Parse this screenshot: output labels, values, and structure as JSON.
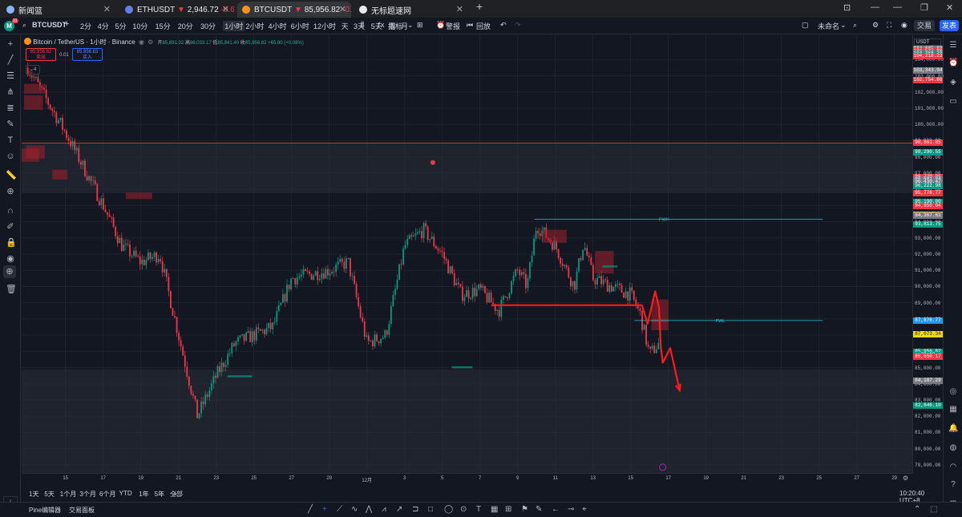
{
  "browser": {
    "tabs": [
      {
        "title": "新闻篮",
        "color": "#8ab4f8",
        "active": false
      },
      {
        "title": "ETHUSDT",
        "price": "2,946.72",
        "change": "-0.61%",
        "arrow": "▼",
        "color": "#627eea",
        "active": false
      },
      {
        "title": "BTCUSDT",
        "price": "85,956.82",
        "change": "-0.55%",
        "arrow": "▼",
        "color": "#f7931a",
        "active": true
      },
      {
        "title": "无标题速网",
        "color": "#e8eaed",
        "active": false
      }
    ],
    "new_tab": "+"
  },
  "toolbar": {
    "avatar_letter": "M",
    "avatar_badge": "31",
    "symbol": "BTCUSDT",
    "add_symbol": "+",
    "intervals": [
      "2分",
      "4分",
      "5分",
      "10分",
      "15分",
      "20分",
      "30分",
      "1小时",
      "2小时",
      "4小时",
      "6小时",
      "12小时",
      "天",
      "3天",
      "5天",
      "周",
      "月"
    ],
    "active_interval": "1小时",
    "indicators": "指标",
    "alert": "警报",
    "replay": "回放",
    "layout_name": "未命名",
    "trade": "交易",
    "publish": "发表"
  },
  "legend": {
    "title": "Bitcoin / TetherUS · 1小时 · Binance",
    "open_label": "开",
    "open": "85,891.02",
    "high_label": "高",
    "high": "86,033.17",
    "low_label": "低",
    "low": "85,841.40",
    "close_label": "收",
    "close": "85,956.82",
    "change": "+65.80 (+0.08%)",
    "sell_price": "85,956.82",
    "sell_label": "卖出",
    "spread": "0.01",
    "buy_price": "85,956.83",
    "buy_label": "买入",
    "collapse": "4"
  },
  "chart_data": {
    "type": "candlestick",
    "symbol": "BTCUSDT",
    "interval": "1小时",
    "exchange": "Binance",
    "ylim": [
      78500,
      105500
    ],
    "x_ticks": [
      "15",
      "17",
      "19",
      "21",
      "23",
      "25",
      "27",
      "29",
      "12月",
      "3",
      "5",
      "7",
      "9",
      "11",
      "13",
      "15",
      "17",
      "19",
      "21",
      "23",
      "25",
      "27",
      "29"
    ],
    "y_ticks": [
      79000,
      80000,
      81000,
      82000,
      83000,
      84000,
      85000,
      86000,
      87000,
      88000,
      89000,
      90000,
      91000,
      92000,
      93000,
      94000,
      95000,
      96000,
      97000,
      98000,
      99000,
      100000,
      101000,
      102000,
      103000,
      104000
    ],
    "trend_path": [
      {
        "x": "11/13",
        "y": 103500
      },
      {
        "x": "11/15",
        "y": 99500
      },
      {
        "x": "11/17",
        "y": 95000
      },
      {
        "x": "11/18",
        "y": 92500
      },
      {
        "x": "11/19",
        "y": 91500
      },
      {
        "x": "11/20",
        "y": 92000
      },
      {
        "x": "11/21",
        "y": 87000
      },
      {
        "x": "11/22",
        "y": 82000
      },
      {
        "x": "11/23",
        "y": 84500
      },
      {
        "x": "11/24",
        "y": 86500
      },
      {
        "x": "11/26",
        "y": 87500
      },
      {
        "x": "11/27",
        "y": 90500
      },
      {
        "x": "11/29",
        "y": 91000
      },
      {
        "x": "11/30",
        "y": 91500
      },
      {
        "x": "12/1",
        "y": 86500
      },
      {
        "x": "12/2",
        "y": 87000
      },
      {
        "x": "12/3",
        "y": 92500
      },
      {
        "x": "12/4",
        "y": 93500
      },
      {
        "x": "12/5",
        "y": 92000
      },
      {
        "x": "12/6",
        "y": 89500
      },
      {
        "x": "12/7",
        "y": 89800
      },
      {
        "x": "12/8",
        "y": 88500
      },
      {
        "x": "12/9",
        "y": 91000
      },
      {
        "x": "12/9 12:00",
        "y": 90000
      },
      {
        "x": "12/10",
        "y": 93800
      },
      {
        "x": "12/11",
        "y": 92500
      },
      {
        "x": "12/12",
        "y": 90000
      },
      {
        "x": "12/12 12:00",
        "y": 92700
      },
      {
        "x": "12/13",
        "y": 90500
      },
      {
        "x": "12/14",
        "y": 90000
      },
      {
        "x": "12/15",
        "y": 89500
      },
      {
        "x": "12/15 12:00",
        "y": 88300
      },
      {
        "x": "12/16",
        "y": 85800
      },
      {
        "x": "12/16 12:00",
        "y": 86500
      }
    ],
    "levels": [
      {
        "label": "PWH",
        "price": 94150
      },
      {
        "label": "PWL",
        "price": 87900
      }
    ],
    "zones": [
      {
        "top": 98850,
        "bottom": 95750
      },
      {
        "top": 84900,
        "bottom": 78500
      }
    ],
    "arrows": "red hand-drawn arrows pointing down toward ~83,200"
  },
  "price_axis": {
    "currency": "USDT",
    "labels": [
      {
        "price": 104635.62,
        "text": "104,635.62",
        "color": "#787b86"
      },
      {
        "price": 104554.32,
        "text": "104,554.32",
        "color": "#787b86"
      },
      {
        "price": 104532.66,
        "text": "104,532.66",
        "color": "#f23645"
      },
      {
        "price": 104368.19,
        "text": "104,368.19",
        "color": "#089981"
      },
      {
        "price": 104233.68,
        "text": "104,233.68",
        "color": "#f23645"
      },
      {
        "price": 104218.23,
        "text": "104,218.23",
        "color": "#f23645"
      },
      {
        "price": 103343.94,
        "text": "103,343.94",
        "color": "#787b86"
      },
      {
        "price": 102754.86,
        "text": "102,754.86",
        "color": "#f23645"
      },
      {
        "price": 98861.85,
        "text": "98,861.85",
        "color": "#f23645"
      },
      {
        "price": 98290.55,
        "text": "98,290.55",
        "color": "#089981"
      },
      {
        "price": 96729.95,
        "text": "96,729.95",
        "color": "#f23645"
      },
      {
        "price": 96581.84,
        "text": "96,581.84",
        "color": "#787b86"
      },
      {
        "price": 96430.47,
        "text": "96,430.47",
        "color": "#787b86"
      },
      {
        "price": 96222.98,
        "text": "96,222.98",
        "color": "#089981"
      },
      {
        "price": 95776.77,
        "text": "95,776.77",
        "color": "#f23645"
      },
      {
        "price": 95190.0,
        "text": "95,190.00",
        "color": "#089981"
      },
      {
        "price": 94950.94,
        "text": "94,950.94",
        "color": "#f23645"
      },
      {
        "price": 94420.0,
        "text": "94,420.00",
        "color": "#f5d90a"
      },
      {
        "price": 94367.61,
        "text": "94,367.61",
        "color": "#787b86"
      },
      {
        "price": 93813.75,
        "text": "93,813.75",
        "color": "#089981"
      },
      {
        "price": 87876.77,
        "text": "87,876.77",
        "color": "#2196f3"
      },
      {
        "price": 87073.34,
        "text": "87,073.34",
        "color": "#f5d90a"
      },
      {
        "price": 85956.82,
        "text": "85,956.82",
        "color": "#089981"
      },
      {
        "price": 85785.0,
        "text": "39:20",
        "color": "#089981"
      },
      {
        "price": 85688.92,
        "text": "85,688.92",
        "color": "#f5d90a"
      },
      {
        "price": 85650.17,
        "text": "85,650.17",
        "color": "#f23645"
      },
      {
        "price": 84187.29,
        "text": "84,187.29",
        "color": "#787b86"
      },
      {
        "price": 82646.1,
        "text": "82,646.10",
        "color": "#089981"
      }
    ]
  },
  "range_bar": {
    "ranges": [
      "1天",
      "5天",
      "1个月",
      "3个月",
      "6个月",
      "YTD",
      "1年",
      "5年",
      "全部"
    ],
    "clock": "10:20:40 UTC+8"
  },
  "bottom": {
    "pine_editor": "Pine编辑器",
    "trading_panel": "交易面板"
  }
}
